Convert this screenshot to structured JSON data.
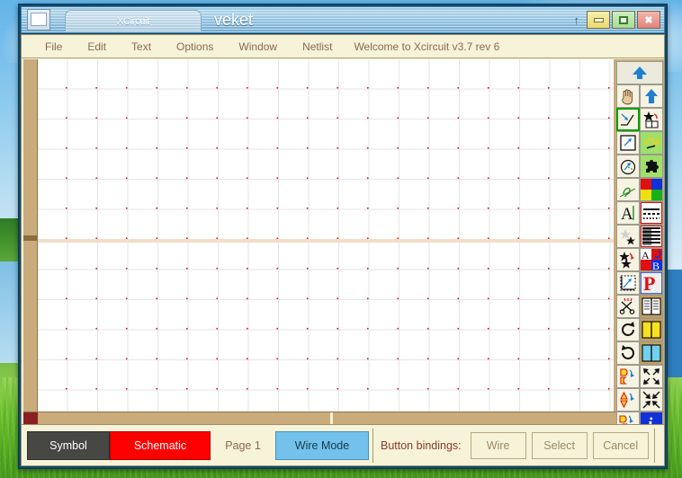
{
  "window": {
    "tab_label": "XCircuit",
    "title": "veket",
    "icon": "window-document-icon",
    "up_caret": "↑",
    "buttons": {
      "minimize": "minimize-button",
      "maximize": "maximize-button",
      "close_glyph": "✖"
    }
  },
  "menubar": {
    "items": [
      {
        "label": "File"
      },
      {
        "label": "Edit"
      },
      {
        "label": "Text"
      },
      {
        "label": "Options"
      },
      {
        "label": "Window"
      },
      {
        "label": "Netlist"
      }
    ],
    "message": "Welcome to Xcircuit v3.7 rev 6"
  },
  "canvas": {
    "grid_color": "#e6e6e6",
    "dot_color": "#e22020",
    "axis_color": "#f0dfc8",
    "background": "#ffffff"
  },
  "palette": {
    "scroll_up": "▲",
    "scroll_down": "▼",
    "tools": [
      {
        "name": "pan-hand-tool",
        "selected": false
      },
      {
        "name": "move-up-arrow-tool",
        "selected": false
      },
      {
        "name": "wire-draw-tool",
        "selected": true
      },
      {
        "name": "library-star-book-tool",
        "selected": false
      },
      {
        "name": "box-draw-tool",
        "selected": false
      },
      {
        "name": "library-page-tool",
        "selected": false
      },
      {
        "name": "arc-draw-tool",
        "selected": false
      },
      {
        "name": "library-puzzle-tool",
        "selected": false
      },
      {
        "name": "spline-draw-tool",
        "selected": false
      },
      {
        "name": "color-palette-tool",
        "selected": false
      },
      {
        "name": "text-tool",
        "selected": false
      },
      {
        "name": "line-style-tool",
        "selected": false
      },
      {
        "name": "deselect-star-tool",
        "selected": false
      },
      {
        "name": "fill-pattern-tool",
        "selected": false
      },
      {
        "name": "copy-star-tool",
        "selected": false
      },
      {
        "name": "font-style-tool",
        "selected": false
      },
      {
        "name": "push-edit-tool",
        "selected": false
      },
      {
        "name": "parameter-p-tool",
        "selected": false
      },
      {
        "name": "cut-scissors-tool",
        "selected": false
      },
      {
        "name": "library-white-book-tool",
        "selected": false
      },
      {
        "name": "rotate-cw-tool",
        "selected": false
      },
      {
        "name": "library-yellow-book-tool",
        "selected": false
      },
      {
        "name": "rotate-ccw-tool",
        "selected": false
      },
      {
        "name": "library-blue-book-tool",
        "selected": false
      },
      {
        "name": "flip-horizontal-tool",
        "selected": false
      },
      {
        "name": "zoom-in-tool",
        "selected": false
      },
      {
        "name": "flip-vertical-tool",
        "selected": false
      },
      {
        "name": "zoom-out-tool",
        "selected": false
      },
      {
        "name": "copy-shape-tool",
        "selected": false
      },
      {
        "name": "info-tool",
        "selected": false
      }
    ]
  },
  "statusbar": {
    "symbol_label": "Symbol",
    "schematic_label": "Schematic",
    "page_label": "Page 1",
    "mode_label": "Wire Mode",
    "bindings_label": "Button bindings:",
    "bindings": [
      {
        "label": "Wire"
      },
      {
        "label": "Select"
      },
      {
        "label": "Cancel"
      }
    ]
  },
  "colors": {
    "frame": "#0e4a6b",
    "app_bg": "#f6f3d8",
    "palette_bg": "#c9ab7c",
    "schematic_red": "#ff0000",
    "wire_blue": "#74c2ec",
    "symbol_gray": "#474744"
  }
}
